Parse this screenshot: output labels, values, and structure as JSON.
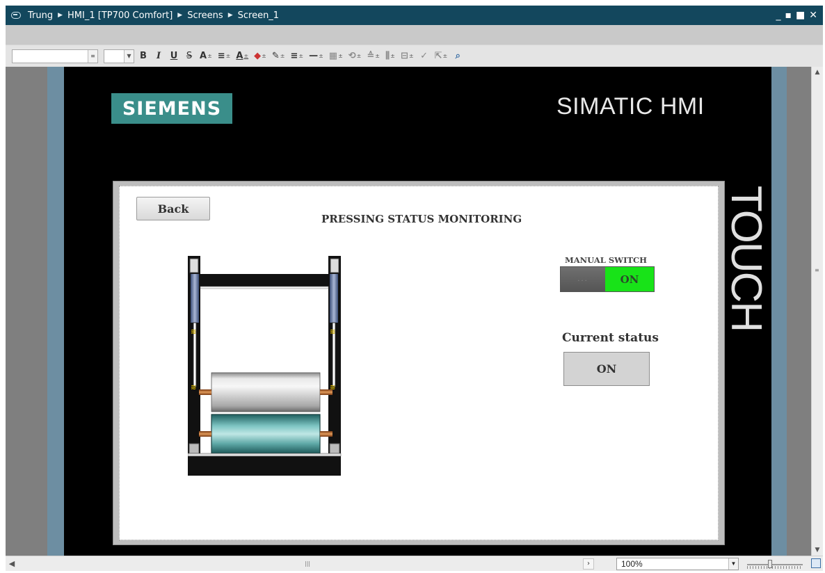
{
  "window": {
    "breadcrumb": [
      "Trung",
      "HMI_1 [TP700 Comfort]",
      "Screens",
      "Screen_1"
    ],
    "controls": [
      "_",
      "▪",
      "■",
      "✕"
    ]
  },
  "toolbar": {
    "font_value": "",
    "size_value": "",
    "bold": "B",
    "italic": "I",
    "underline": "U",
    "strike": "S",
    "superscript": "A",
    "align": "≡",
    "font_color": "A",
    "fill": "◆",
    "pen": "✎",
    "line_style": "≡",
    "line": "—",
    "bring_front": "▦",
    "rotate": "⟲",
    "align_objs": "≙",
    "distribute": "⫼",
    "spacing": "⊟",
    "format_painter": "✓",
    "layers": "⇱",
    "zoom_select": "⌕"
  },
  "device": {
    "brand": "SIEMENS",
    "panel_name": "SIMATIC HMI",
    "side_text": "TOUCH"
  },
  "screen": {
    "back_label": "Back",
    "title": "PRESSING STATUS MONITORING",
    "manual_switch_label": "MANUAL SWITCH",
    "switch_on_label": "ON",
    "switch_off_label": "...",
    "switch_state": "ON",
    "current_status_label": "Current status",
    "current_status_value": "ON"
  },
  "statusbar": {
    "zoom": "100%",
    "zoom_slider_fraction": 0.4
  },
  "colors": {
    "title_bar": "#13475d",
    "siemens_teal": "#3a8e8a",
    "switch_on_green": "#18e318"
  }
}
